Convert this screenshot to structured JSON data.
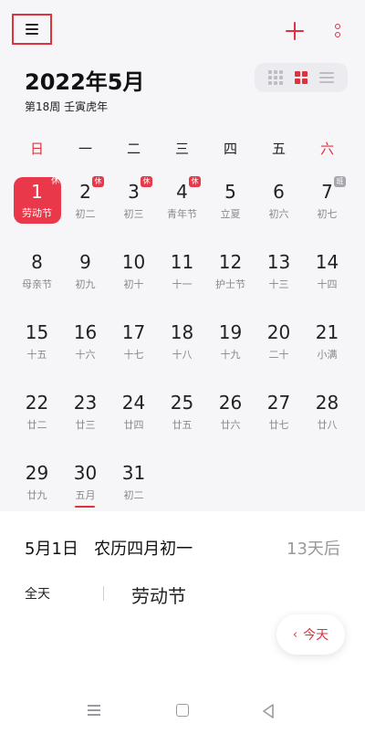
{
  "topbar": {
    "menu_icon": "menu-icon",
    "add_icon": "plus-icon",
    "more_icon": "more-vertical-icon"
  },
  "header": {
    "title": "2022年5月",
    "subtitle": "第18周 壬寅虎年"
  },
  "view_switch": {
    "options": [
      "year-view-icon",
      "month-view-icon",
      "list-view-icon"
    ],
    "active": "month-view-icon"
  },
  "weekdays": [
    "日",
    "一",
    "二",
    "三",
    "四",
    "五",
    "六"
  ],
  "days": [
    {
      "num": "1",
      "lunar": "劳动节",
      "badge": "休",
      "selected": true
    },
    {
      "num": "2",
      "lunar": "初二",
      "badge": "休"
    },
    {
      "num": "3",
      "lunar": "初三",
      "badge": "休"
    },
    {
      "num": "4",
      "lunar": "青年节",
      "badge": "休"
    },
    {
      "num": "5",
      "lunar": "立夏"
    },
    {
      "num": "6",
      "lunar": "初六"
    },
    {
      "num": "7",
      "lunar": "初七",
      "badge": "班"
    },
    {
      "num": "8",
      "lunar": "母亲节"
    },
    {
      "num": "9",
      "lunar": "初九"
    },
    {
      "num": "10",
      "lunar": "初十"
    },
    {
      "num": "11",
      "lunar": "十一"
    },
    {
      "num": "12",
      "lunar": "护士节"
    },
    {
      "num": "13",
      "lunar": "十三"
    },
    {
      "num": "14",
      "lunar": "十四"
    },
    {
      "num": "15",
      "lunar": "十五"
    },
    {
      "num": "16",
      "lunar": "十六"
    },
    {
      "num": "17",
      "lunar": "十七"
    },
    {
      "num": "18",
      "lunar": "十八"
    },
    {
      "num": "19",
      "lunar": "十九"
    },
    {
      "num": "20",
      "lunar": "二十"
    },
    {
      "num": "21",
      "lunar": "小满"
    },
    {
      "num": "22",
      "lunar": "廿二"
    },
    {
      "num": "23",
      "lunar": "廿三"
    },
    {
      "num": "24",
      "lunar": "廿四"
    },
    {
      "num": "25",
      "lunar": "廿五"
    },
    {
      "num": "26",
      "lunar": "廿六"
    },
    {
      "num": "27",
      "lunar": "廿七"
    },
    {
      "num": "28",
      "lunar": "廿八"
    },
    {
      "num": "29",
      "lunar": "廿九"
    },
    {
      "num": "30",
      "lunar": "五月",
      "today": true
    },
    {
      "num": "31",
      "lunar": "初二"
    }
  ],
  "detail": {
    "date": "5月1日",
    "lunar_date": "农历四月初一",
    "countdown": "13天后",
    "allday_label": "全天",
    "event": "劳动节"
  },
  "today_button": {
    "label": "今天",
    "icon": "chevron-left-icon"
  },
  "system_nav": [
    "recent-apps-icon",
    "home-icon",
    "back-icon"
  ],
  "colors": {
    "accent": "#e0313f",
    "selected_bg": "#e8384a",
    "calendar_bg": "#f6f6f9"
  }
}
